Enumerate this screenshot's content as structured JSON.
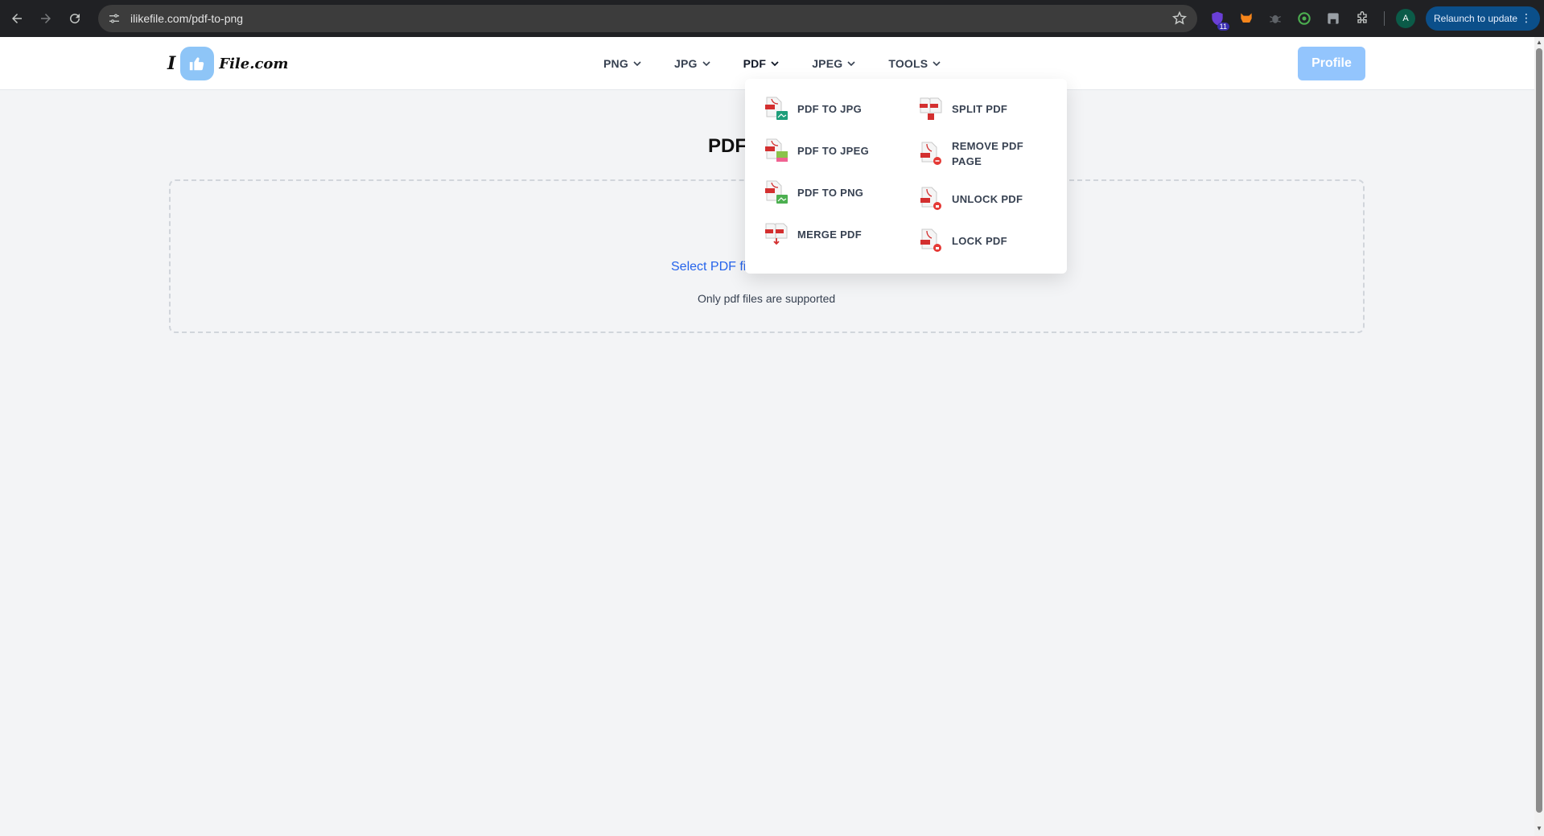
{
  "browser": {
    "url": "ilikefile.com/pdf-to-png",
    "avatar_letter": "A",
    "relaunch_label": "Relaunch to update",
    "extension_badge": "11"
  },
  "header": {
    "logo_i": "I",
    "logo_word": "File.com",
    "menu": [
      {
        "label": "PNG"
      },
      {
        "label": "JPG"
      },
      {
        "label": "PDF"
      },
      {
        "label": "JPEG"
      },
      {
        "label": "TOOLS"
      }
    ],
    "profile_label": "Profile"
  },
  "main": {
    "title": "PDF",
    "select_link": "Select PDF fi",
    "support_text": "Only pdf files are supported"
  },
  "dropdown": {
    "left": [
      {
        "label": "PDF TO JPG",
        "icon": "pdf-to-jpg-icon"
      },
      {
        "label": "PDF TO JPEG",
        "icon": "pdf-to-jpeg-icon"
      },
      {
        "label": "PDF TO PNG",
        "icon": "pdf-to-png-icon"
      },
      {
        "label": "MERGE PDF",
        "icon": "merge-pdf-icon"
      }
    ],
    "right": [
      {
        "label": "SPLIT PDF",
        "icon": "split-pdf-icon"
      },
      {
        "label": "REMOVE PDF PAGE",
        "icon": "remove-pdf-page-icon"
      },
      {
        "label": "UNLOCK PDF",
        "icon": "unlock-pdf-icon"
      },
      {
        "label": "LOCK PDF",
        "icon": "lock-pdf-icon"
      }
    ]
  },
  "colors": {
    "accent": "#2563eb",
    "profile_bg": "#93c5fd",
    "logo_badge": "#8ec5f7",
    "pdf_red": "#d32f2f"
  }
}
